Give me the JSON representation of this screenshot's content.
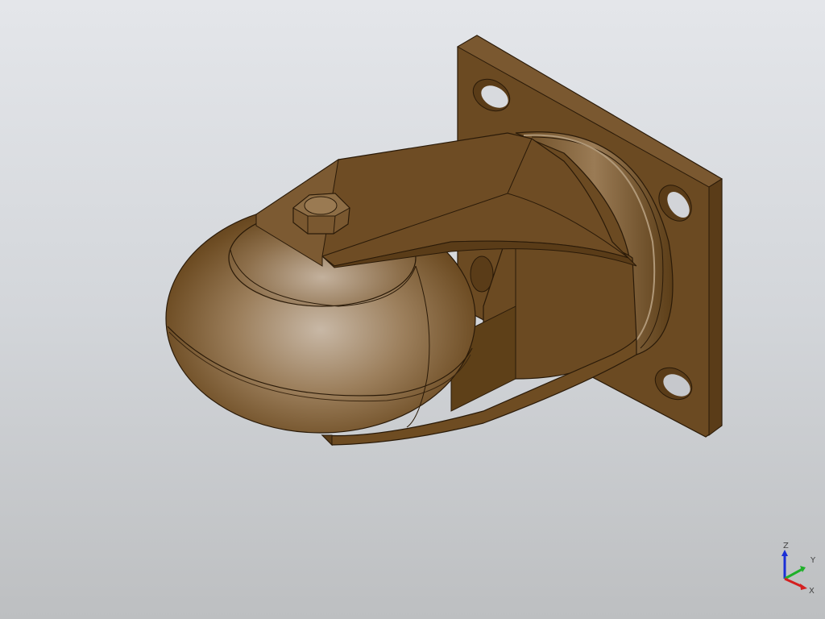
{
  "viewport": {
    "model": "caster-wheel-assembly",
    "material_colors": {
      "base": "#6b4a22",
      "dark": "#4e3414",
      "mid": "#8a6a42",
      "light": "#c4b3a0",
      "edge": "#2a1a08"
    }
  },
  "axis_triad": {
    "z_label": "Z",
    "y_label": "Y",
    "x_label": "X",
    "z_color": "#1a2fd6",
    "y_color": "#1fb02a",
    "x_color": "#d42020"
  }
}
